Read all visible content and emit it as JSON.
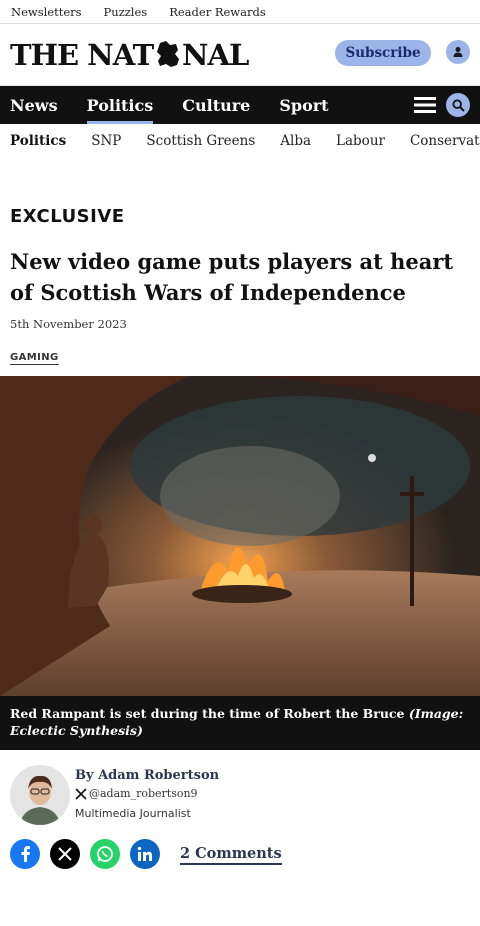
{
  "topbar": {
    "items": [
      "Newsletters",
      "Puzzles",
      "Reader Rewards"
    ]
  },
  "header": {
    "logo_text": "THE NATIONAL",
    "subscribe_label": "Subscribe"
  },
  "nav": {
    "items": [
      "News",
      "Politics",
      "Culture",
      "Sport"
    ],
    "active": "Politics"
  },
  "subnav": {
    "items": [
      "Politics",
      "SNP",
      "Scottish Greens",
      "Alba",
      "Labour",
      "Conservatives"
    ],
    "active": "Politics"
  },
  "article": {
    "kicker": "EXCLUSIVE",
    "headline": "New video game puts players at heart of Scottish Wars of Independence",
    "date": "5th November 2023",
    "tag": "GAMING",
    "caption_text": "Red Rampant is set during the time of Robert the Bruce ",
    "caption_credit": "(Image: Eclectic Synthesis)"
  },
  "author": {
    "by_label": "By",
    "name": "Adam Robertson",
    "handle": "@adam_robertson9",
    "role": "Multimedia Journalist"
  },
  "share": {
    "comments_label": "2 Comments"
  },
  "colors": {
    "accent": "#9db4e8",
    "nav_bg": "#111111",
    "facebook": "#1877f2",
    "whatsapp": "#25d366",
    "linkedin": "#0a66c2",
    "x": "#000000"
  },
  "icons": [
    "user-icon",
    "menu-icon",
    "search-icon",
    "x-logo-icon",
    "facebook-icon",
    "whatsapp-icon",
    "linkedin-icon"
  ]
}
